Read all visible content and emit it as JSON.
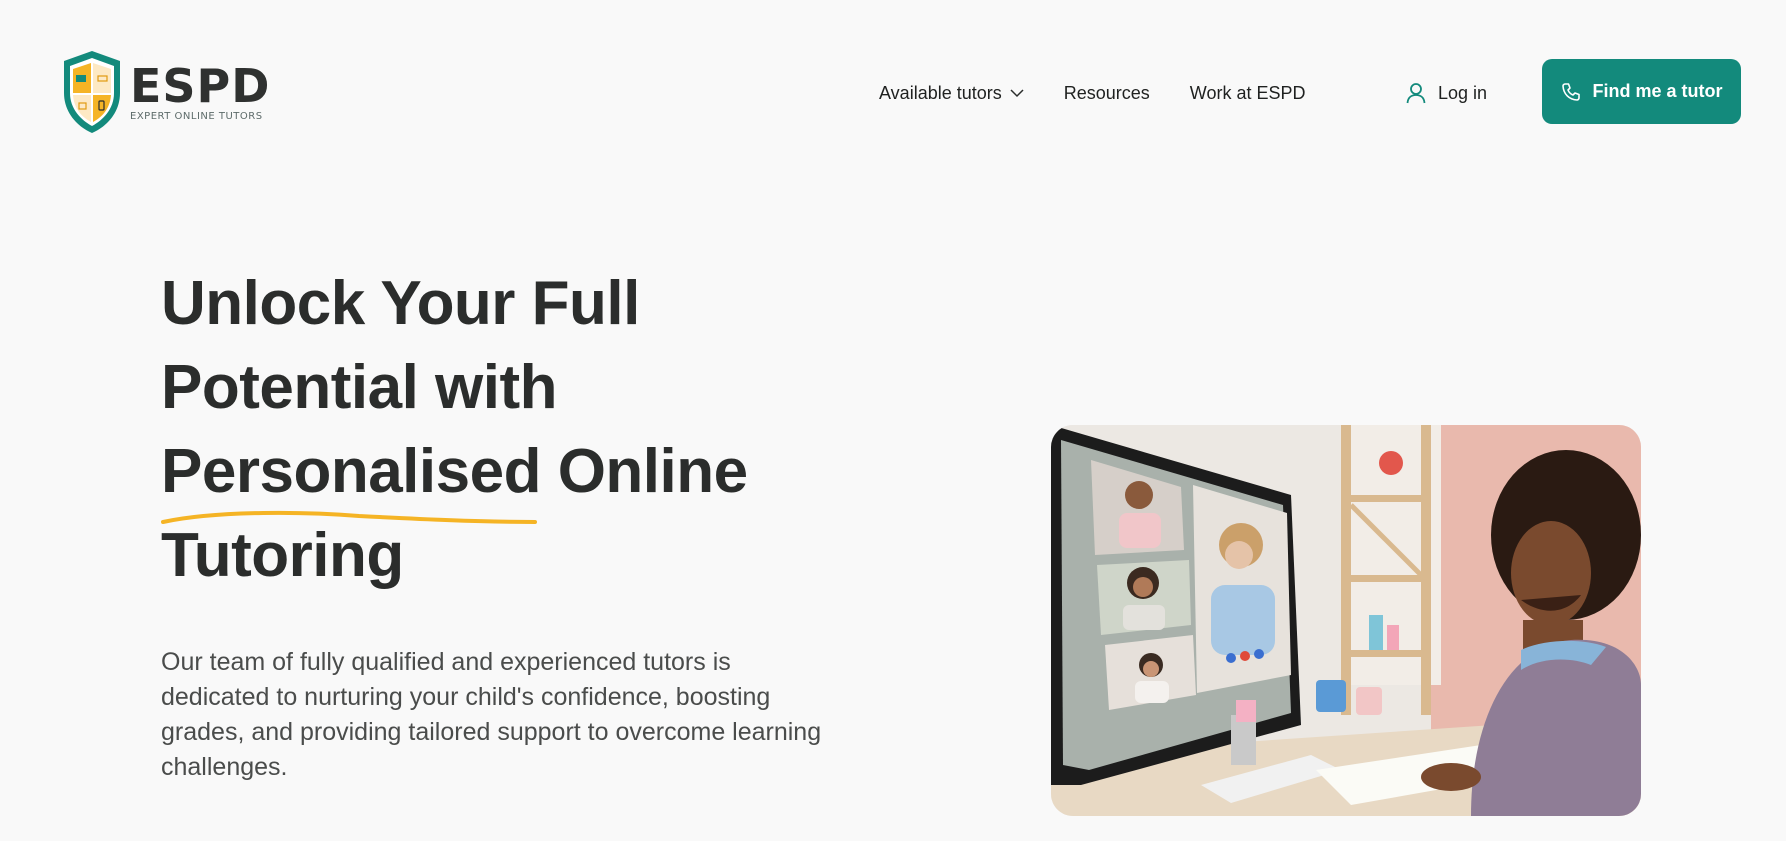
{
  "brand": {
    "name": "ESPD",
    "tagline": "EXPERT ONLINE TUTORS",
    "primary_color": "#138a7c",
    "accent_color": "#f5b425"
  },
  "nav": {
    "items": [
      {
        "label": "Available tutors",
        "has_dropdown": true,
        "icon": "chevron-down-icon"
      },
      {
        "label": "Resources"
      },
      {
        "label": "Work at ESPD"
      }
    ],
    "login_label": "Log in",
    "login_icon": "user-icon",
    "cta_label": "Find me a tutor",
    "cta_icon": "phone-icon"
  },
  "hero": {
    "title_lines": [
      "Unlock Your Full",
      "Potential with"
    ],
    "title_underlined": "Personalised",
    "title_line3_rest": " Online",
    "title_line4": "Tutoring",
    "description": "Our team of fully qualified and experienced tutors is dedicated to nurturing your child's confidence, boosting grades, and providing tailored support to overcome learning challenges.",
    "image_icon": "student-video-call-photo"
  }
}
